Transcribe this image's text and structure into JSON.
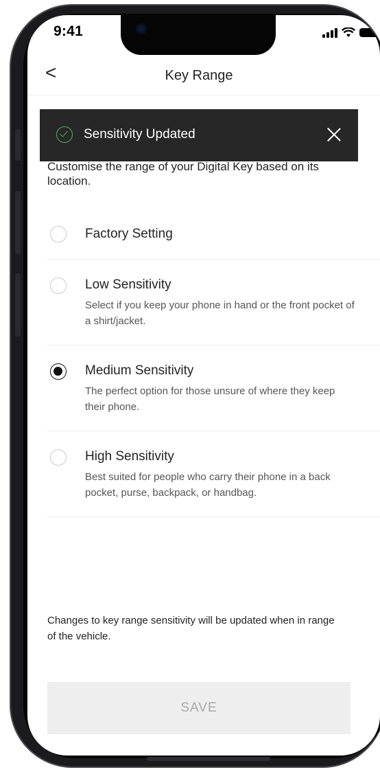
{
  "status_bar": {
    "time": "9:41"
  },
  "header": {
    "back_glyph": "<",
    "title": "Key Range"
  },
  "toast": {
    "message": "Sensitivity Updated",
    "icon": "check-circle-icon",
    "close_icon": "close-icon",
    "accent": "#4fb06a"
  },
  "intro": {
    "line1": "Customise the range of your Digital Key based on its",
    "line2": "location."
  },
  "options": [
    {
      "label": "Factory Setting",
      "description": "",
      "selected": false
    },
    {
      "label": "Low Sensitivity",
      "description": "Select if you keep your phone in hand or the front pocket of a shirt/jacket.",
      "selected": false
    },
    {
      "label": "Medium Sensitivity",
      "description": "The perfect option for those unsure of where they keep their phone.",
      "selected": true
    },
    {
      "label": "High Sensitivity",
      "description": "Best suited for people who carry their phone in a back pocket, purse, backpack, or handbag.",
      "selected": false
    }
  ],
  "note": "Changes to key range sensitivity will be updated when in range of the vehicle.",
  "save_button": {
    "label": "SAVE",
    "enabled": false
  }
}
